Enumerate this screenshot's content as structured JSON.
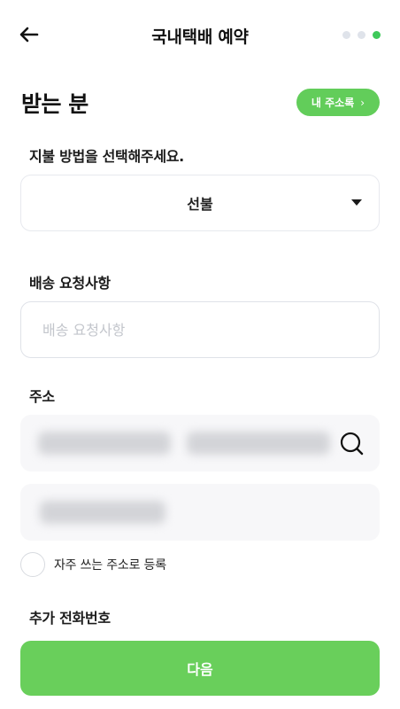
{
  "header": {
    "back_icon": "arrow-left-icon",
    "title": "국내택배 예약",
    "steps_total": 3,
    "current_step": 3,
    "step_active_color": "#3fc95a",
    "step_inactive_color": "#dfe3ea"
  },
  "receiver": {
    "section_title": "받는 분",
    "address_book_label": "내 주소록",
    "address_book_chevron": "›"
  },
  "payment": {
    "label": "지불 방법을 선택해주세요.",
    "selected": "선불",
    "dropdown_icon": "caret-down-icon"
  },
  "delivery_request": {
    "label": "배송 요청사항",
    "placeholder": "배송 요청사항",
    "value": ""
  },
  "address": {
    "label": "주소",
    "search_icon": "search-icon"
  },
  "save_address": {
    "label": "자주 쓰는 주소로 등록",
    "checked": false
  },
  "extra_phone": {
    "label": "추가 전화번호"
  },
  "footer": {
    "next_label": "다음",
    "accent_color": "#69cf5b"
  }
}
